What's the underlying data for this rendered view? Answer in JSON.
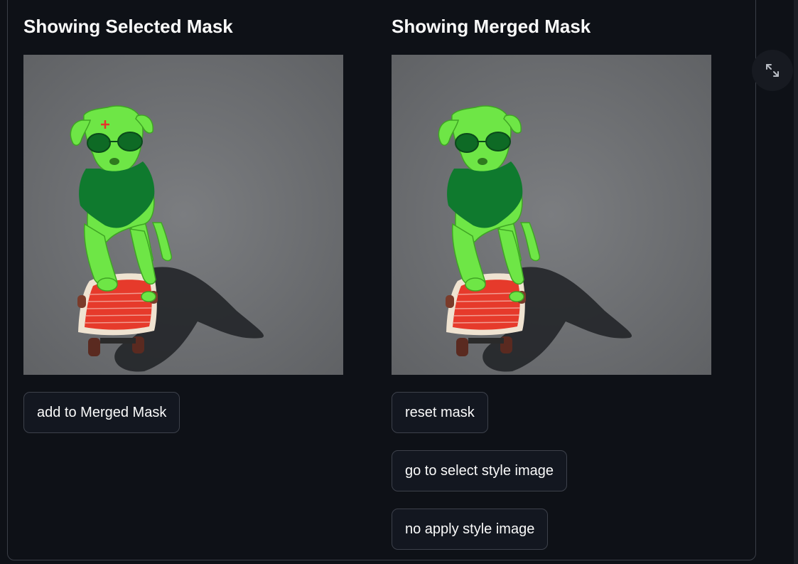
{
  "left_panel": {
    "title": "Showing Selected Mask",
    "image_alt": "Selected mask: green-tinted dog on skateboard with red click marker",
    "button_label": "add to Merged Mask"
  },
  "right_panel": {
    "title": "Showing Merged Mask",
    "image_alt": "Merged mask: green-tinted dog on skateboard",
    "buttons": [
      {
        "label": "reset mask"
      },
      {
        "label": "go to select style image"
      },
      {
        "label": "no apply style image"
      }
    ]
  },
  "toolbar": {
    "expand_icon": "expand-icon"
  },
  "colors": {
    "background": "#0e1117",
    "button_bg": "#131720",
    "button_border": "#3d414b",
    "text": "#fafafa",
    "mask_green": "#5ee03c",
    "click_marker": "#e8332a"
  }
}
